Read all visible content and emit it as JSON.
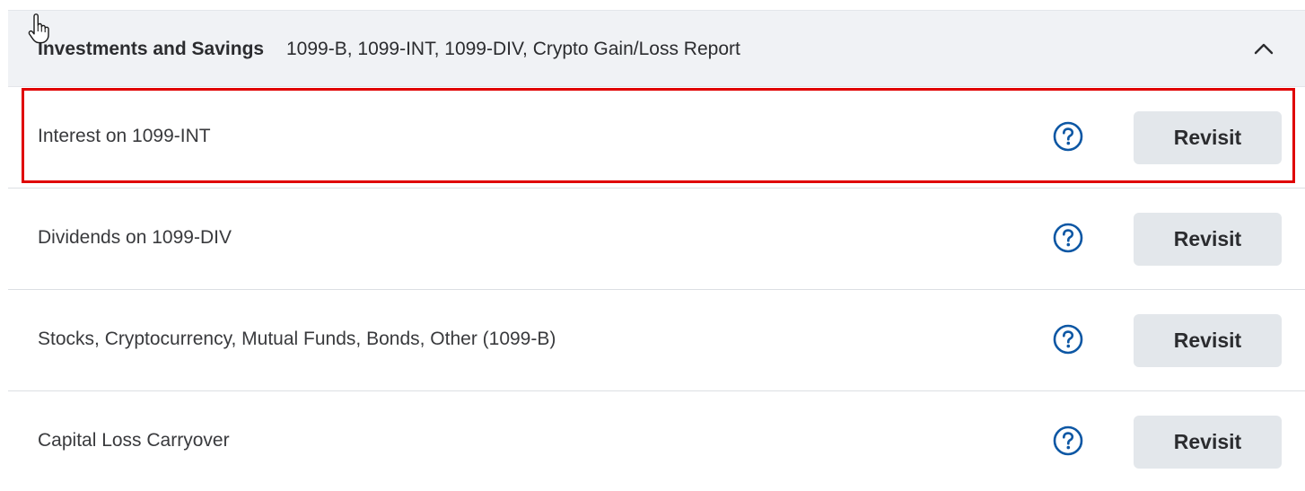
{
  "section": {
    "title": "Investments and Savings",
    "subtitle": "1099-B, 1099-INT, 1099-DIV, Crypto Gain/Loss Report",
    "collapse_icon": "chevron-up-icon"
  },
  "rows": [
    {
      "label": "Interest on 1099-INT",
      "button": "Revisit",
      "help_icon": "question-circle-icon",
      "highlighted": true
    },
    {
      "label": "Dividends on 1099-DIV",
      "button": "Revisit",
      "help_icon": "question-circle-icon"
    },
    {
      "label": "Stocks, Cryptocurrency, Mutual Funds, Bonds, Other (1099-B)",
      "button": "Revisit",
      "help_icon": "question-circle-icon"
    },
    {
      "label": "Capital Loss Carryover",
      "button": "Revisit",
      "help_icon": "question-circle-icon"
    }
  ],
  "colors": {
    "header_bg": "#f0f2f5",
    "button_bg": "#e3e7eb",
    "help_icon": "#0d57a4",
    "highlight": "#e00000"
  }
}
